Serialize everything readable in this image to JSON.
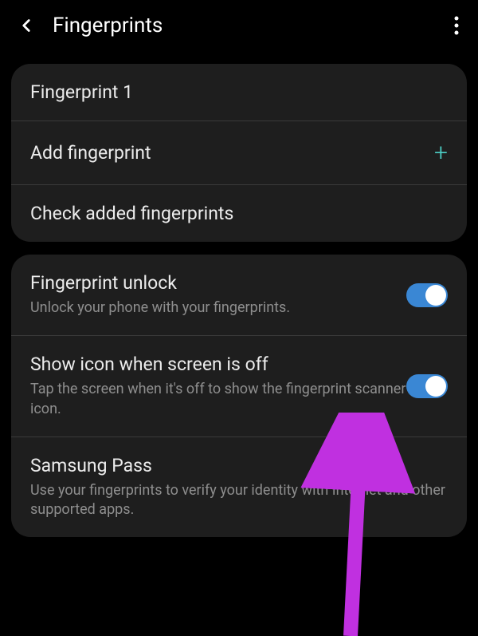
{
  "header": {
    "title": "Fingerprints"
  },
  "section1": {
    "items": [
      {
        "label": "Fingerprint 1"
      },
      {
        "label": "Add fingerprint",
        "has_plus": true
      },
      {
        "label": "Check added fingerprints"
      }
    ]
  },
  "section2": {
    "items": [
      {
        "label": "Fingerprint unlock",
        "subtitle": "Unlock your phone with your fingerprints.",
        "toggle": true
      },
      {
        "label": "Show icon when screen is off",
        "subtitle": "Tap the screen when it's off to show the fingerprint scanner icon.",
        "toggle": true
      },
      {
        "label": "Samsung Pass",
        "subtitle": "Use your fingerprints to verify your identity with Internet and other supported apps."
      }
    ]
  },
  "annotation": {
    "arrow_color": "#c030e0"
  }
}
